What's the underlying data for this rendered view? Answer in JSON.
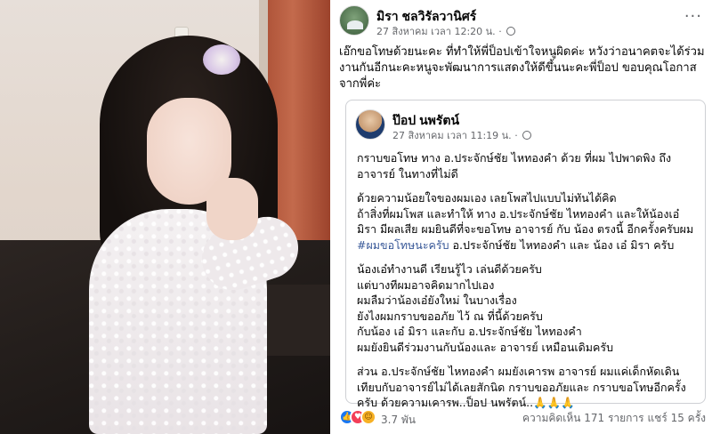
{
  "post": {
    "author": "มิรา ชลวิรัลวานิศร์",
    "date": "27 สิงหาคม เวลา 12:20 น.",
    "dot": "·",
    "caption": "เอ๊กขอโทษด้วยนะคะ ที่ทำให้พี่ป็อปเข้าใจหนูผิดค่ะ หวังว่าอนาคตจะได้ร่วมงานกันอีกนะคะหนูจะพัฒนาการแสดงให้ดีขึ้นนะคะพี่ป็อป ขอบคุณโอกาสจากพี่ค่ะ",
    "more_label": "···"
  },
  "shared": {
    "author": "ป๊อป นพรัตน์",
    "date": "27 สิงหาคม เวลา 11:19 น.",
    "dot": "·",
    "lines": {
      "l1": "กราบขอโทษ ทาง อ.ประจักษ์ชัย ไหทองคำ ด้วย ที่ผม ไปพาดพิง ถึง",
      "l2": "อาจารย์ ในทางที่ไม่ดี",
      "l3": "ด้วยความน้อยใจของผมเอง เลยโพสไปแบบไม่ทันได้คิด",
      "l4": "ถ้าสิ่งที่ผมโพส และทำให้ ทาง อ.ประจักษ์ชัย ไหทองคำ และให้น้องเอ๋",
      "l5": "มิรา มีผลเสีย ผมยินดีที่จะขอโทษ อาจารย์ กับ น้อง ตรงนี้ อีกครั้งครับผม",
      "l6_tag": "#ผมขอโทษนะครับ",
      "l6_rest": " อ.ประจักษ์ชัย ไหทองคำ และ น้อง เอ๋ มิรา ครับ",
      "l7": "น้องเอ๋ทำงานดี เรียนรู้ไว เล่นดีด้วยครับ",
      "l8": "แต่บางทีผมอาจคิดมากไปเอง",
      "l9": "ผมลืมว่าน้องเอ๋ยังใหม่ ในบางเรื่อง",
      "l10": "ยังไงผมกราบขออภัย ไว้ ณ ที่นี้ด้วยครับ",
      "l11": "กับน้อง เอ๋ มิรา และกับ อ.ประจักษ์ชัย ไหทองคำ",
      "l12": "ผมยังยินดีร่วมงานกับน้องและ อาจารย์ เหมือนเดิมครับ",
      "l13": "ส่วน อ.ประจักษ์ชัย ไหทองคำ ผมยังเคารพ อาจารย์ ผมแค่เด็กหัดเดิน",
      "l14": "เทียบกับอาจารย์ไม่ได้เลยสักนิด กราบขออภัยและ กราบขอโทษอีกครั้ง",
      "l15": "ครับ ด้วยความเคารพ..ป็อป นพรัตน์..🙏🙏🙏"
    }
  },
  "footer": {
    "reaction_count": "3.7 พัน",
    "comments_shares": "ความคิดเห็น 171 รายการ  แชร์ 15 ครั้ง",
    "like_icon": "👍",
    "love_icon": "♥",
    "care_icon": "☺"
  }
}
